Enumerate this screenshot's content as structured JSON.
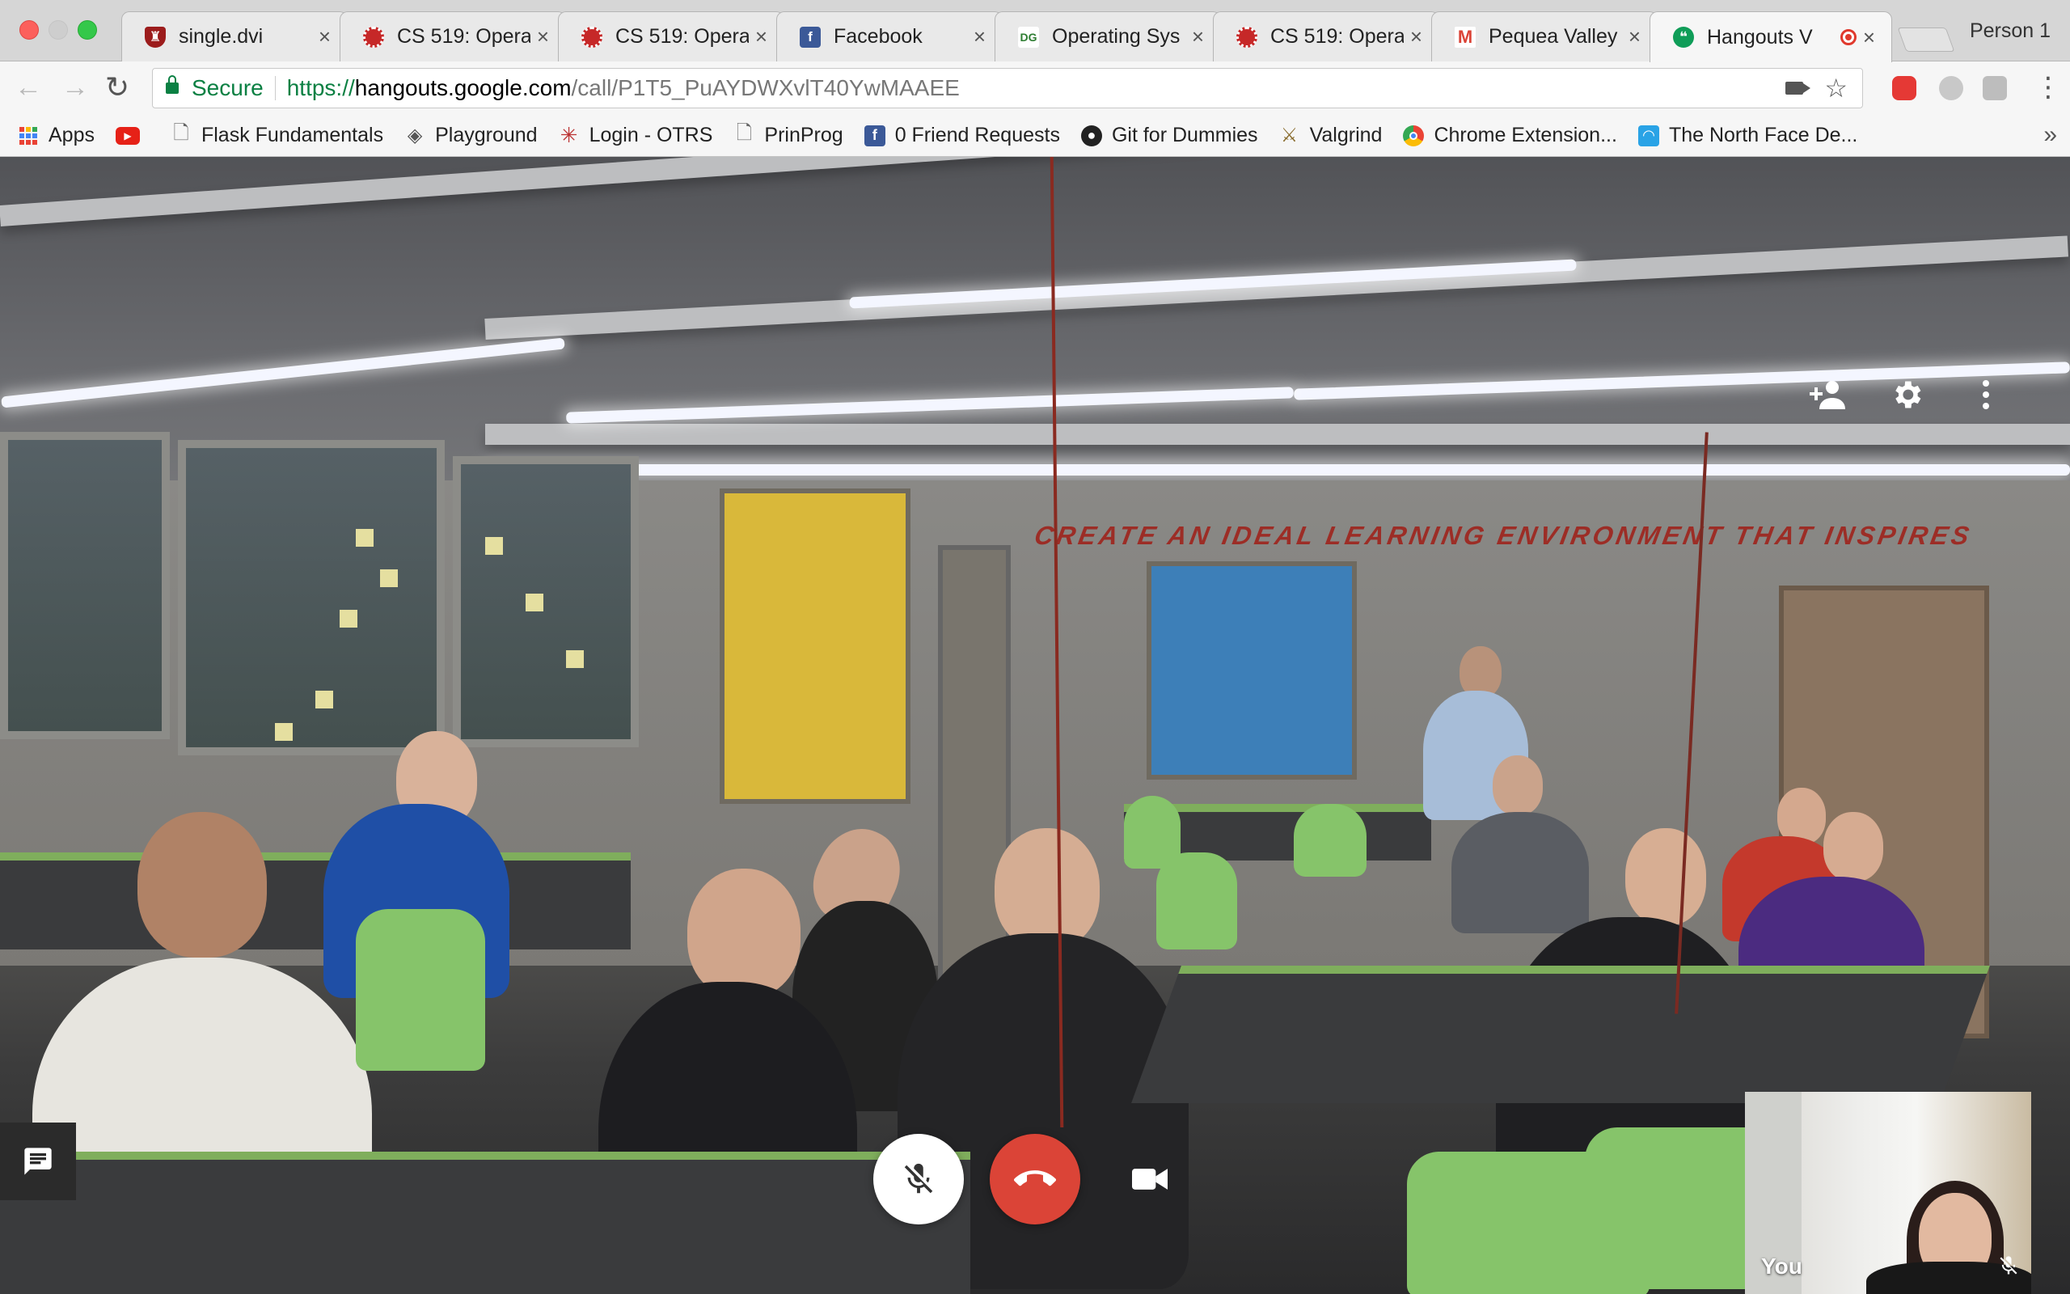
{
  "window": {
    "profile_name": "Person 1"
  },
  "tabs": [
    {
      "title": "single.dvi",
      "favicon": "shield-crest-icon",
      "color": "#9c1c1c"
    },
    {
      "title": "CS 519: Opera",
      "favicon": "cs-seal-icon",
      "color": "#c62828"
    },
    {
      "title": "CS 519: Opera",
      "favicon": "cs-seal-icon",
      "color": "#c62828"
    },
    {
      "title": "Facebook",
      "favicon": "facebook-icon",
      "color": "#3b5998"
    },
    {
      "title": "Operating Sys",
      "favicon": "dg-icon",
      "color": "#2e7d32"
    },
    {
      "title": "CS 519: Opera",
      "favicon": "cs-seal-icon",
      "color": "#c62828"
    },
    {
      "title": "Pequea Valley",
      "favicon": "gmail-icon",
      "color": "#db4437"
    },
    {
      "title": "Hangouts V",
      "favicon": "hangouts-icon",
      "color": "#0f9d58",
      "active": true,
      "recording": true
    }
  ],
  "toolbar": {
    "security_label": "Secure",
    "url_scheme": "https://",
    "url_host": "hangouts.google.com",
    "url_path": "/call/P1T5_PuAYDWXvlT40YwMAAEE"
  },
  "bookmarks": [
    {
      "label": "Apps",
      "icon": "apps-grid-icon"
    },
    {
      "label": "",
      "icon": "youtube-icon"
    },
    {
      "label": "Flask Fundamentals",
      "icon": "page-icon"
    },
    {
      "label": "Playground",
      "icon": "diamond-icon"
    },
    {
      "label": "Login - OTRS",
      "icon": "otrs-icon"
    },
    {
      "label": "PrinProg",
      "icon": "page-icon"
    },
    {
      "label": "0 Friend Requests",
      "icon": "facebook-icon"
    },
    {
      "label": "Git for Dummies",
      "icon": "github-icon"
    },
    {
      "label": "Valgrind",
      "icon": "valgrind-icon"
    },
    {
      "label": "Chrome Extension...",
      "icon": "chrome-icon"
    },
    {
      "label": "The North Face De...",
      "icon": "north-face-icon"
    }
  ],
  "call": {
    "self_label": "You",
    "wall_banner": "CREATE AN IDEAL LEARNING ENVIRONMENT THAT INSPIRES"
  },
  "colors": {
    "hangup_red": "#db4437",
    "secure_green": "#0b8043",
    "desk_green": "#7fae5c"
  }
}
